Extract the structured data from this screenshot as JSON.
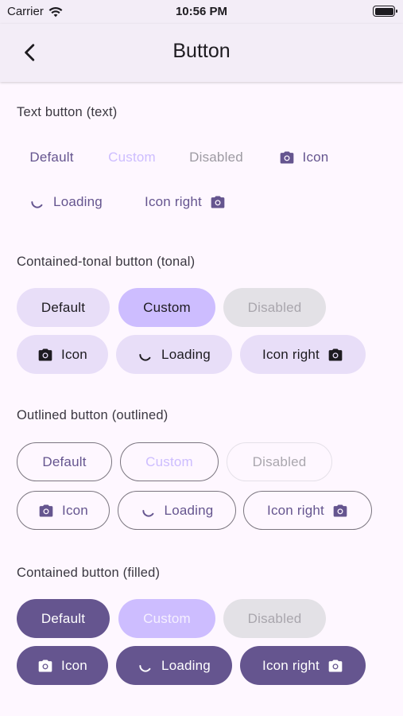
{
  "status": {
    "carrier": "Carrier",
    "time": "10:56 PM"
  },
  "header": {
    "title": "Button",
    "back_icon": "chevron-left-icon"
  },
  "colors": {
    "primary": "#65558F",
    "custom": "#CDBDFF",
    "tonal": "#E8DEF8",
    "disabled_bg": "#E3E1E6",
    "background": "#FEF7FF"
  },
  "sections": {
    "text": {
      "title": "Text button (text)"
    },
    "tonal": {
      "title": "Contained-tonal button (tonal)"
    },
    "outlined": {
      "title": "Outlined button (outlined)"
    },
    "filled": {
      "title": "Contained button (filled)"
    }
  },
  "labels": {
    "default": "Default",
    "custom": "Custom",
    "disabled": "Disabled",
    "icon": "Icon",
    "loading": "Loading",
    "icon_right": "Icon right"
  }
}
